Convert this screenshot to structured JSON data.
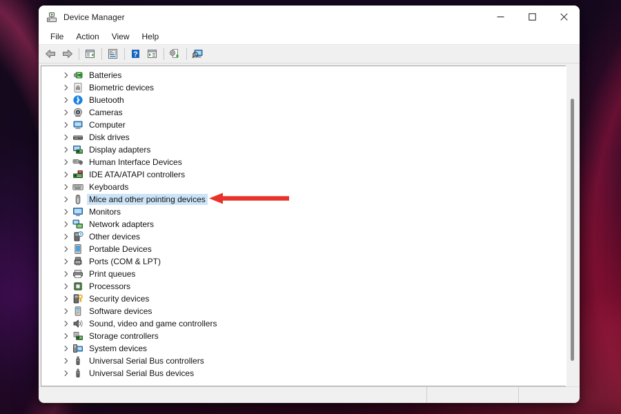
{
  "window": {
    "title": "Device Manager",
    "title_icon": "device-manager-icon",
    "controls": {
      "minimize": "Minimize",
      "maximize": "Maximize",
      "close": "Close"
    }
  },
  "menubar": {
    "items": [
      {
        "label": "File"
      },
      {
        "label": "Action"
      },
      {
        "label": "View"
      },
      {
        "label": "Help"
      }
    ]
  },
  "toolbar": {
    "buttons": [
      {
        "name": "back-button",
        "icon": "back-arrow-icon",
        "label": "Back"
      },
      {
        "name": "forward-button",
        "icon": "forward-arrow-icon",
        "label": "Forward"
      },
      {
        "name": "show-hide-console-tree-button",
        "icon": "console-tree-icon",
        "label": "Show/Hide Console Tree"
      },
      {
        "name": "properties-button",
        "icon": "properties-icon",
        "label": "Properties"
      },
      {
        "name": "help-button",
        "icon": "help-question-icon",
        "label": "Help"
      },
      {
        "name": "show-hide-action-pane-button",
        "icon": "action-pane-icon",
        "label": "Show/Hide Action Pane"
      },
      {
        "name": "update-driver-button",
        "icon": "update-driver-icon",
        "label": "Update Driver Software"
      },
      {
        "name": "scan-for-hardware-changes-button",
        "icon": "scan-hardware-icon",
        "label": "Scan for hardware changes"
      }
    ]
  },
  "tree": {
    "selected_index": 10,
    "items": [
      {
        "label": "Batteries",
        "icon": "battery-icon"
      },
      {
        "label": "Biometric devices",
        "icon": "fingerprint-icon"
      },
      {
        "label": "Bluetooth",
        "icon": "bluetooth-icon"
      },
      {
        "label": "Cameras",
        "icon": "camera-icon"
      },
      {
        "label": "Computer",
        "icon": "computer-icon"
      },
      {
        "label": "Disk drives",
        "icon": "disk-drive-icon"
      },
      {
        "label": "Display adapters",
        "icon": "display-adapter-icon"
      },
      {
        "label": "Human Interface Devices",
        "icon": "hid-icon"
      },
      {
        "label": "IDE ATA/ATAPI controllers",
        "icon": "ide-controller-icon"
      },
      {
        "label": "Keyboards",
        "icon": "keyboard-icon"
      },
      {
        "label": "Mice and other pointing devices",
        "icon": "mouse-icon"
      },
      {
        "label": "Monitors",
        "icon": "monitor-icon"
      },
      {
        "label": "Network adapters",
        "icon": "network-adapter-icon"
      },
      {
        "label": "Other devices",
        "icon": "other-device-icon"
      },
      {
        "label": "Portable Devices",
        "icon": "portable-device-icon"
      },
      {
        "label": "Ports (COM & LPT)",
        "icon": "port-icon"
      },
      {
        "label": "Print queues",
        "icon": "printer-icon"
      },
      {
        "label": "Processors",
        "icon": "processor-icon"
      },
      {
        "label": "Security devices",
        "icon": "security-device-icon"
      },
      {
        "label": "Software devices",
        "icon": "software-device-icon"
      },
      {
        "label": "Sound, video and game controllers",
        "icon": "speaker-icon"
      },
      {
        "label": "Storage controllers",
        "icon": "storage-controller-icon"
      },
      {
        "label": "System devices",
        "icon": "system-device-icon"
      },
      {
        "label": "Universal Serial Bus controllers",
        "icon": "usb-icon"
      },
      {
        "label": "Universal Serial Bus devices",
        "icon": "usb-icon"
      }
    ]
  },
  "statusbar": {
    "panes": [
      "",
      "",
      ""
    ]
  },
  "annotation": {
    "arrow": "red-left-arrow-annotation"
  },
  "colors": {
    "selection": "#cce4f7",
    "annotation_red": "#e8322a",
    "toolbar_bg": "#f0f0f0",
    "window_bg": "#ffffff",
    "text": "#111111"
  }
}
